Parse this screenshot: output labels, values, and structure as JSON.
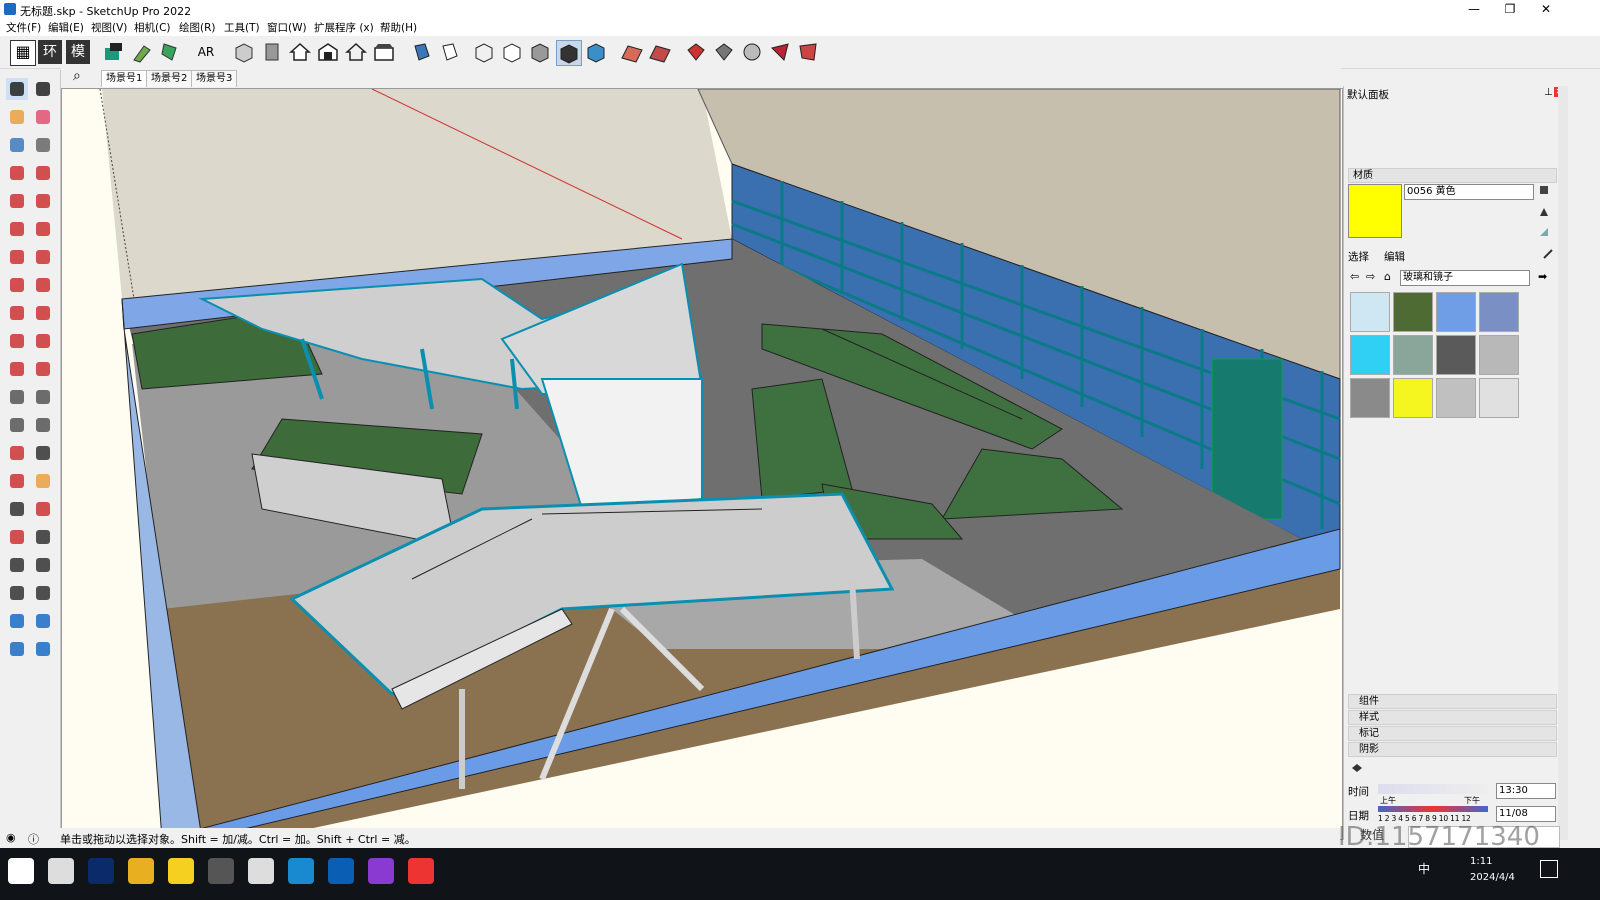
{
  "window": {
    "title": "无标题.skp - SketchUp Pro 2022",
    "minimize": "—",
    "restore": "❐",
    "close": "✕"
  },
  "menus": [
    "文件(F)",
    "编辑(E)",
    "视图(V)",
    "相机(C)",
    "绘图(R)",
    "工具(T)",
    "窗口(W)",
    "扩展程序 (x)",
    "帮助(H)"
  ],
  "toolbar": {
    "icons": [
      "report-icon",
      "environment-icon",
      "model-icon",
      "component-icon",
      "paint-tools-icon",
      "styles-icon",
      "ar-icon",
      "box-view-icon",
      "section-icon",
      "house-icon",
      "warehouse-icon",
      "home-outline-icon",
      "storefront-icon",
      "xray-icon",
      "backedges-icon",
      "wireframe-icon",
      "hiddenline-icon",
      "shaded-icon",
      "shaded-texture-icon",
      "monochrome-icon",
      "sandbox-terrain-icon",
      "sandbox-grid-icon",
      "export-icon",
      "download-icon",
      "share-icon",
      "extension-icon",
      "ruby-icon"
    ],
    "texts": {
      "tb_table": "▦",
      "tb_env": "环",
      "tb_model": "模",
      "tb_ar": "AR"
    }
  },
  "scenes": {
    "search_icon": "⌕",
    "tabs": [
      "场景号1",
      "场景号2",
      "场景号3"
    ]
  },
  "lefttools": [
    "select-icon",
    "orbit-select-icon",
    "paint-bucket-icon",
    "eraser-icon",
    "component-3d-icon",
    "tag-icon",
    "pencil-icon",
    "freehand-icon",
    "rectangle-icon",
    "rotated-rect-icon",
    "circle-icon",
    "polygon-icon",
    "arc-icon",
    "arc-2pt-icon",
    "arc-3pt-icon",
    "pie-icon",
    "move-icon",
    "push-pull-icon",
    "rotate-icon",
    "follow-me-icon",
    "scale-icon",
    "offset-icon",
    "tape-measure-icon",
    "dimension-icon",
    "protractor-icon",
    "text-icon",
    "axes-icon",
    "3d-text-icon",
    "orbit-icon",
    "pan-icon",
    "zoom-icon",
    "zoom-window-icon",
    "zoom-extents-icon",
    "previous-view-icon",
    "position-camera-icon",
    "look-around-icon",
    "walk-icon",
    "section-plane-icon",
    "sandbox-icon",
    "stamp-icon",
    "drape-icon",
    "smoove-icon"
  ],
  "panel": {
    "title": "默认面板",
    "material_section": "材质",
    "material_name": "0056 黄色",
    "material_color": "#FFFF00",
    "tab_select": "选择",
    "tab_edit": "编辑",
    "library": "玻璃和镜子",
    "swatches": [
      "#cfe6f3",
      "#4d6b32",
      "#6f9ee6",
      "#7a8fc4",
      "#2fd0f4",
      "#8aa69a",
      "#5a5a5a",
      "#b8b8b8",
      "#8a8a8a",
      "#f5f520",
      "#c0c0c0",
      "#e0e0e0"
    ],
    "collapsed_sections": [
      "组件",
      "样式",
      "标记"
    ],
    "shadow_section": "阴影",
    "time_label": "时间",
    "time_value": "13:30",
    "date_label": "日期",
    "date_value": "11/08",
    "months": "1 2 3 4 5 6 7 8 9 10 11 12",
    "am_label": "上午",
    "pm_label": "下午"
  },
  "status": {
    "text": "单击或拖动以选择对象。Shift = 加/减。Ctrl = 加。Shift + Ctrl = 减。",
    "measure_label": "数值",
    "watermark_id": "ID:1157171340"
  },
  "taskbar": {
    "apps": [
      "windows-start-icon",
      "task-view-icon",
      "photoshop-icon",
      "file-explorer-icon",
      "sticky-notes-icon",
      "calculator-icon",
      "qq-icon",
      "edge-icon",
      "sketchup-icon",
      "podcast-icon",
      "qq-penguin-icon"
    ],
    "clock_time": "1:11",
    "clock_date": "2024/4/4",
    "ime": "中"
  },
  "colors": {
    "accent": "#1a6bc4",
    "taskbar": "#101418",
    "viewport_bg": "#fffdf2"
  }
}
